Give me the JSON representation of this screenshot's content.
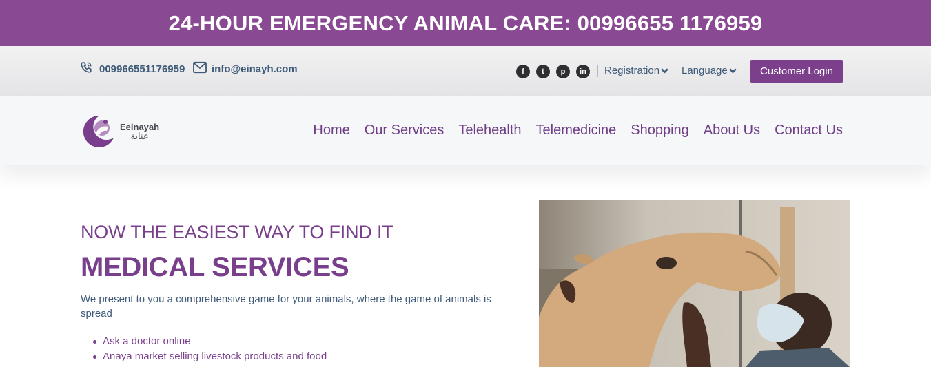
{
  "banner": {
    "text": "24-HOUR EMERGENCY ANIMAL CARE: 00996655 1176959"
  },
  "contact": {
    "phone": "009966551176959",
    "email": "info@einayh.com"
  },
  "socials": [
    {
      "name": "facebook-icon",
      "glyph": "f"
    },
    {
      "name": "twitter-icon",
      "glyph": "t"
    },
    {
      "name": "pinterest-icon",
      "glyph": "p"
    },
    {
      "name": "linkedin-icon",
      "glyph": "in"
    }
  ],
  "header": {
    "registration": "Registration",
    "language": "Language",
    "login": "Customer Login"
  },
  "logo": {
    "name_en": "Eeinayah",
    "name_ar": "عناية"
  },
  "nav": [
    "Home",
    "Our Services",
    "Telehealth",
    "Telemedicine",
    "Shopping",
    "About Us",
    "Contact Us"
  ],
  "hero": {
    "subtitle": "NOW THE EASIEST WAY TO FIND IT",
    "title": "MEDICAL SERVICES",
    "description": "We present to you a comprehensive game for your animals, where the game of animals is spread",
    "bullets": [
      "Ask a doctor online",
      "Anaya market selling livestock products and food"
    ]
  },
  "colors": {
    "brand_purple": "#8a4a93",
    "button_purple": "#7b3f8c",
    "text_blue": "#3f5a78"
  }
}
